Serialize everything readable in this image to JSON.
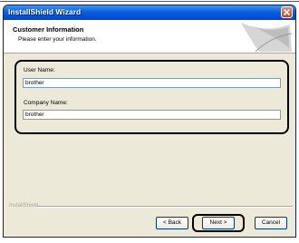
{
  "window": {
    "title": "InstallShield Wizard"
  },
  "header": {
    "title": "Customer Information",
    "subtitle": "Please enter your information."
  },
  "form": {
    "user_name_label": "User Name:",
    "user_name_value": "brother",
    "company_name_label": "Company Name:",
    "company_name_value": "brother"
  },
  "footer": {
    "brand": "InstallShield"
  },
  "buttons": {
    "back": "< Back",
    "next": "Next >",
    "cancel": "Cancel"
  },
  "colors": {
    "titlebar": "#0054e3",
    "dialog_bg": "#ece9d8",
    "close_button": "#c8431f"
  },
  "icons": [
    "close-icon",
    "wizard-header-graphic"
  ]
}
